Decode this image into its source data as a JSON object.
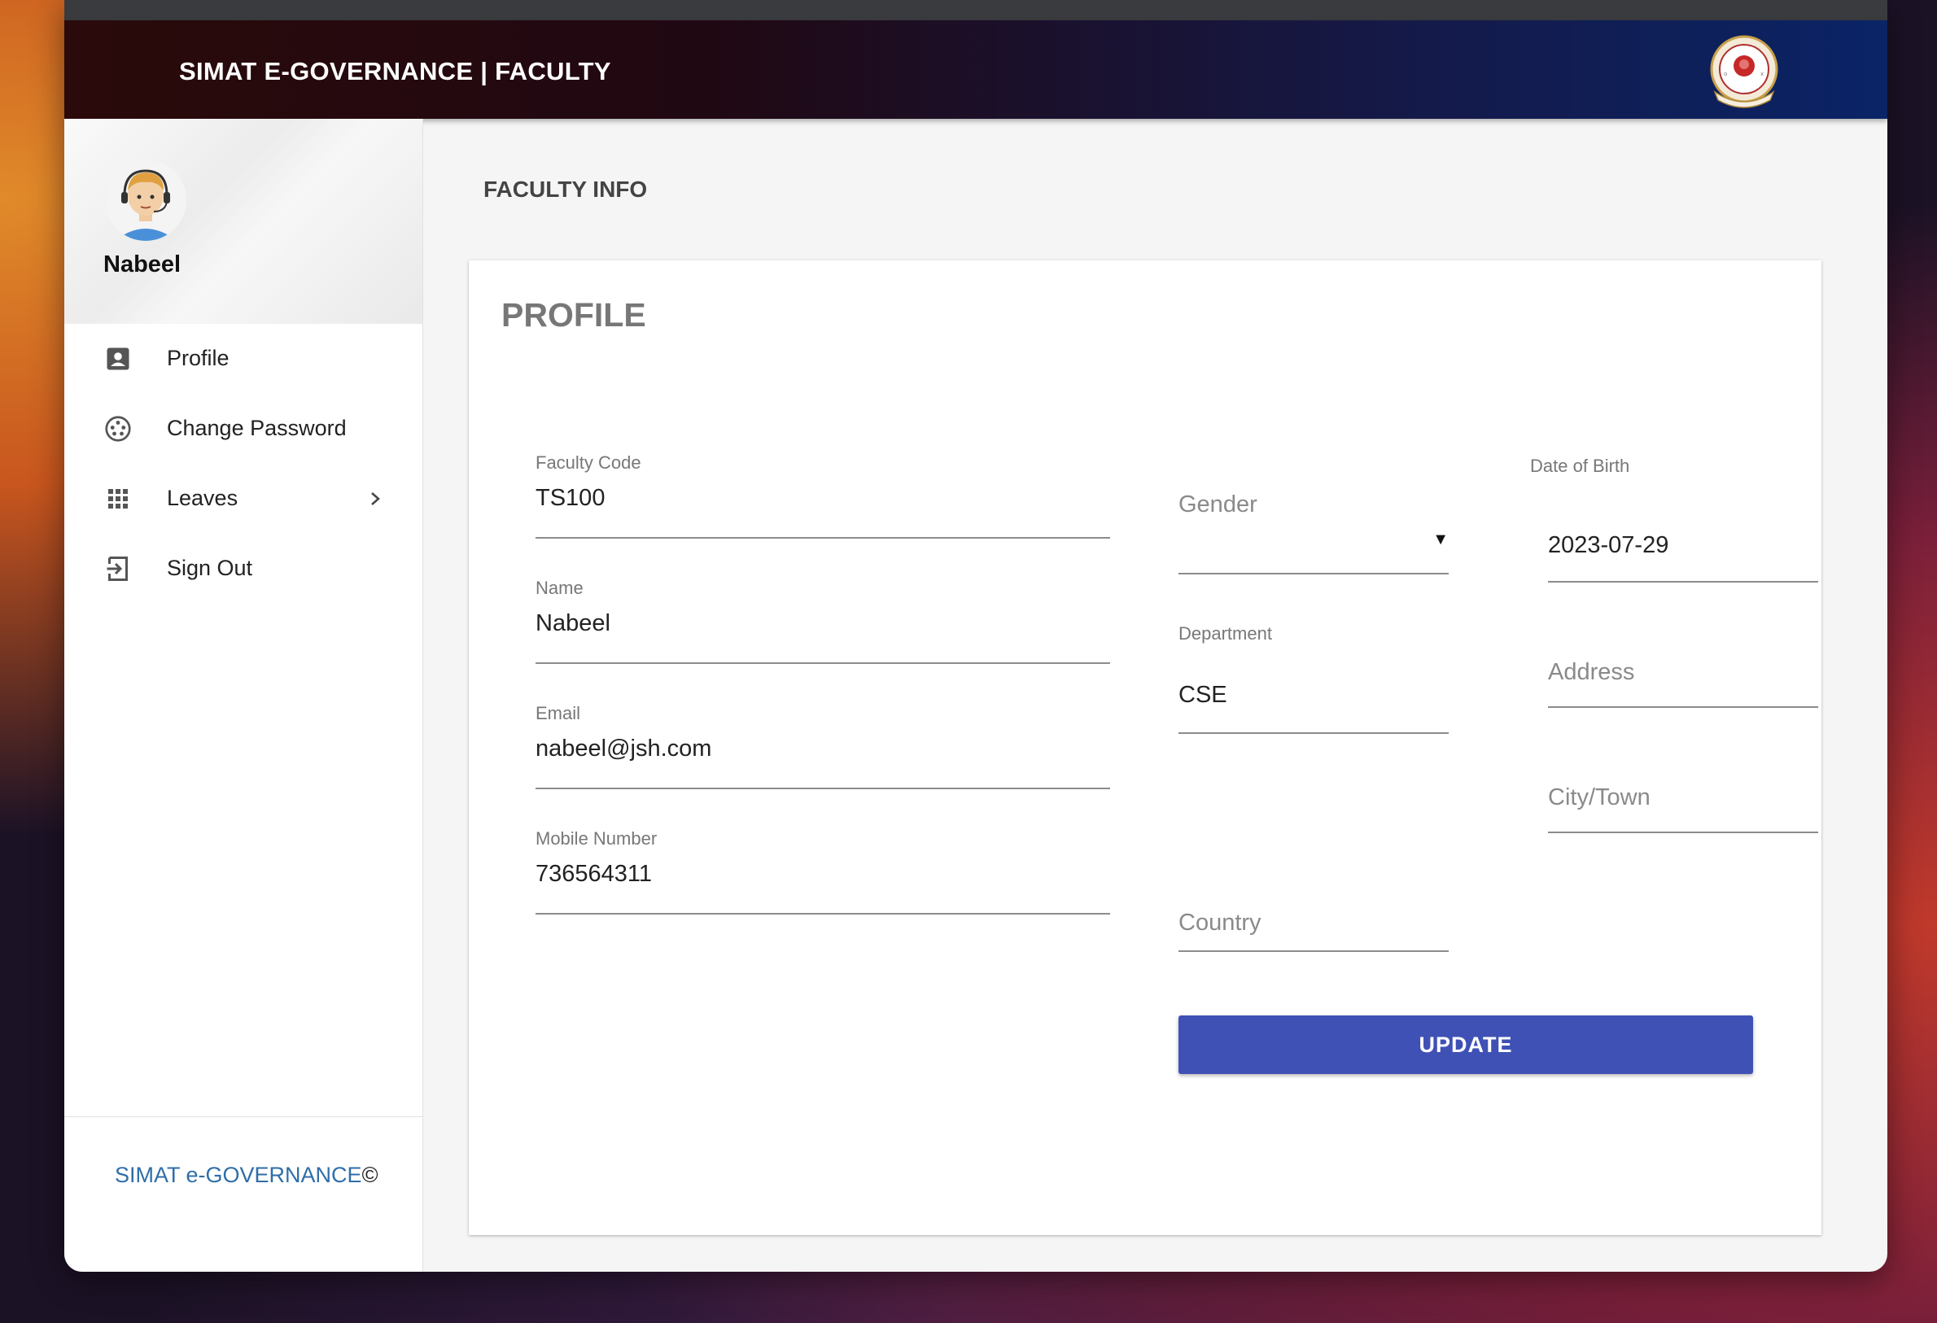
{
  "app": {
    "title": "SIMAT E-GOVERNANCE | FACULTY",
    "logo_icon": "college-seal-logo"
  },
  "user": {
    "name": "Nabeel",
    "avatar_icon": "user-avatar-headset"
  },
  "sidebar": {
    "items": [
      {
        "label": "Profile",
        "icon": "profile-card-icon"
      },
      {
        "label": "Change Password",
        "icon": "password-dial-icon"
      },
      {
        "label": "Leaves",
        "icon": "grid-apps-icon",
        "has_submenu": true
      },
      {
        "label": "Sign Out",
        "icon": "sign-out-icon"
      }
    ],
    "footer": {
      "text": "SIMAT e-GOVERNANCE",
      "symbol": "©"
    }
  },
  "page": {
    "heading": "FACULTY INFO"
  },
  "profile": {
    "title": "PROFILE",
    "faculty_code": {
      "label": "Faculty Code",
      "value": "TS100"
    },
    "name": {
      "label": "Name",
      "value": "Nabeel"
    },
    "email": {
      "label": "Email",
      "value": "nabeel@jsh.com"
    },
    "mobile": {
      "label": "Mobile Number",
      "value": "736564311"
    },
    "gender": {
      "placeholder": "Gender",
      "value": ""
    },
    "dob": {
      "label": "Date of Birth",
      "value": "2023-07-29"
    },
    "department": {
      "label": "Department",
      "value": "CSE"
    },
    "address": {
      "placeholder": "Address"
    },
    "city": {
      "placeholder": "City/Town"
    },
    "country": {
      "placeholder": "Country"
    },
    "update_label": "UPDATE"
  },
  "colors": {
    "primary_button": "#3f51b5",
    "footer_link": "#2f6ea8",
    "appbar_start": "#2a0a0a",
    "appbar_end": "#0a2466"
  }
}
